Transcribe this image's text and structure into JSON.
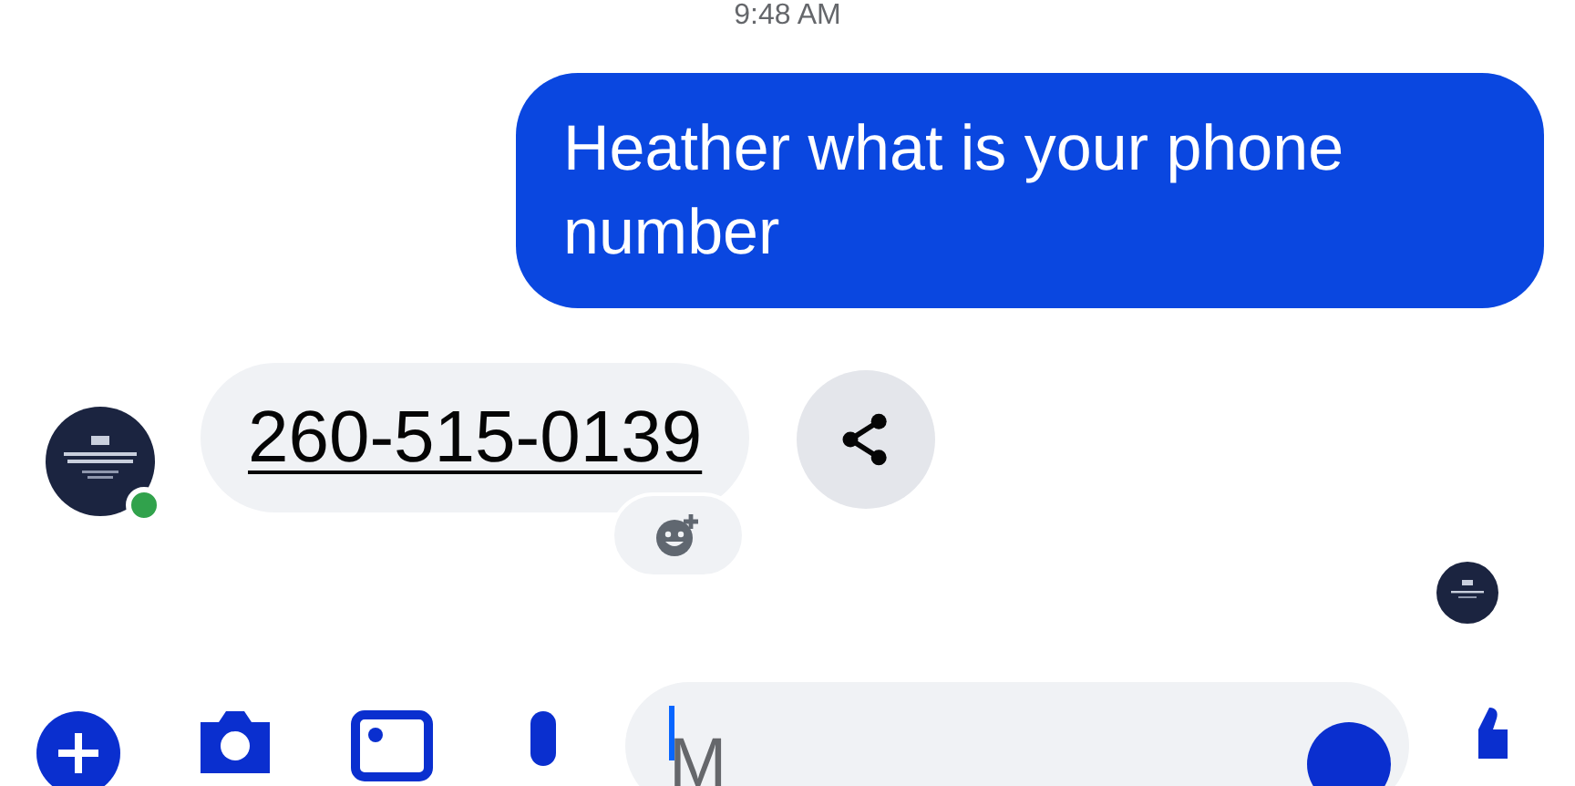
{
  "timestamp": "9:48 AM",
  "sent_message": {
    "text": "Heather what is your phone number"
  },
  "received_message": {
    "text": "260-515-0139",
    "sender_online": true
  },
  "composer": {
    "placeholder": "M"
  }
}
